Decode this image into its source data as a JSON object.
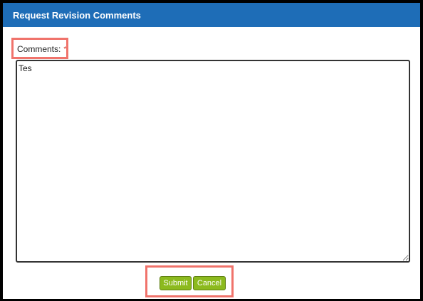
{
  "dialog": {
    "title": "Request Revision Comments"
  },
  "comments": {
    "label": "Comments:",
    "required_marker": "*",
    "value": "Tes"
  },
  "buttons": {
    "submit_label": "Submit",
    "cancel_label": "Cancel"
  },
  "colors": {
    "header_bg": "#1e6db7",
    "button_bg": "#8cba1e",
    "highlight_border": "#f0736b"
  }
}
